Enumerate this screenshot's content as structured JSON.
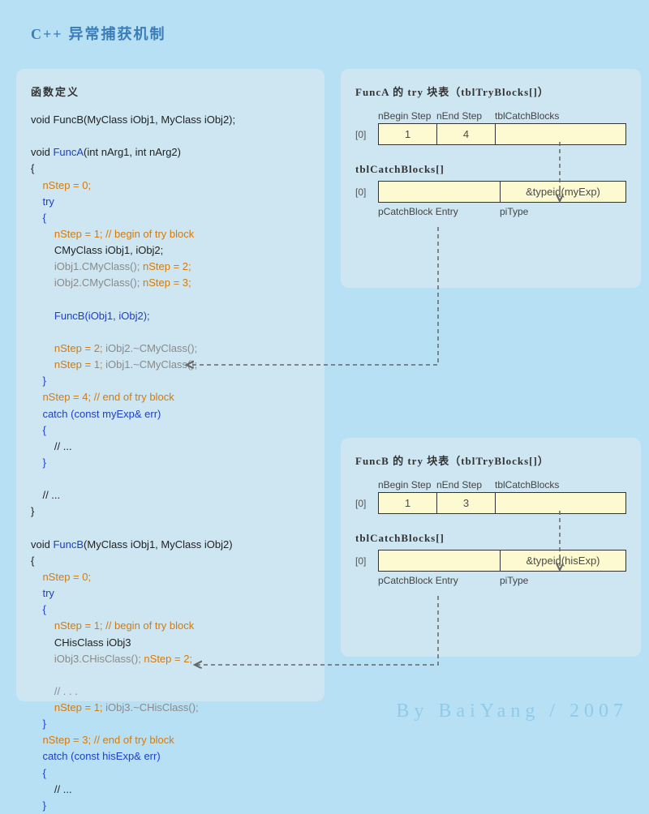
{
  "title": {
    "cpp": "C++",
    "rest": " 异常捕获机制"
  },
  "footer": "By BaiYang / 2007",
  "codePanel": {
    "header": "函数定义"
  },
  "code": {
    "l1a": "void FuncB(MyClass iObj1, MyClass iObj2);",
    "l2a": "void ",
    "l2b": "FuncA",
    "l2c": "(int nArg1, int nArg2)",
    "l3": "{",
    "l4": "nStep = 0;",
    "l5": "try",
    "l6": "{",
    "l7a": "nStep = 1; ",
    "l7b": "// begin of try block",
    "l8": "CMyClass iObj1, iObj2;",
    "l9a": "iObj1.CMyClass(); ",
    "l9b": "nStep = 2;",
    "l10a": "iObj2.CMyClass(); ",
    "l10b": "nStep = 3;",
    "l11": "FuncB(iObj1, iObj2);",
    "l12a": "nStep = 2; ",
    "l12b": "iObj2.~CMyClass();",
    "l13a": "nStep = 1; ",
    "l13b": "iObj1.~CMyClass();",
    "l14": "}",
    "l15a": "nStep = 4; ",
    "l15b": "// end of try block",
    "l16": "catch (const myExp& err)",
    "l17": "{",
    "l18": "// ...",
    "l19": "}",
    "l20": "// ...",
    "l21": "}",
    "m2a": "void ",
    "m2b": "FuncB",
    "m2c": "(MyClass iObj1, MyClass iObj2)",
    "m3": "{",
    "m4": "nStep = 0;",
    "m5": "try",
    "m6": "{",
    "m7a": "nStep = 1; ",
    "m7b": "// begin of try block",
    "m8": "CHisClass iObj3",
    "m9a": "iObj3.CHisClass(); ",
    "m9b": "nStep = 2;",
    "m10": "// . . .",
    "m11a": "nStep = 1; ",
    "m11b": "iObj3.~CHisClass();",
    "m14": "}",
    "m15a": "nStep = 3; ",
    "m15b": "// end of try block",
    "m16": "catch (const hisExp& err)",
    "m17": "{",
    "m18": "// ...",
    "m19": "}"
  },
  "panelA": {
    "header": "FuncA 的 try 块表（tblTryBlocks[]）",
    "labels": {
      "nBegin": "nBegin Step",
      "nEnd": "nEnd Step",
      "catch": "tblCatchBlocks"
    },
    "idx": "[0]",
    "nBegin": "1",
    "nEnd": "4",
    "subhead": "tblCatchBlocks[]",
    "typeid": "&typeid(myExp)",
    "below": {
      "entry": "pCatchBlock Entry",
      "pi": "piType"
    }
  },
  "panelB": {
    "header": "FuncB 的 try 块表（tblTryBlocks[]）",
    "labels": {
      "nBegin": "nBegin Step",
      "nEnd": "nEnd Step",
      "catch": "tblCatchBlocks"
    },
    "idx": "[0]",
    "nBegin": "1",
    "nEnd": "3",
    "subhead": "tblCatchBlocks[]",
    "typeid": "&typeid(hisExp)",
    "below": {
      "entry": "pCatchBlock Entry",
      "pi": "piType"
    }
  }
}
